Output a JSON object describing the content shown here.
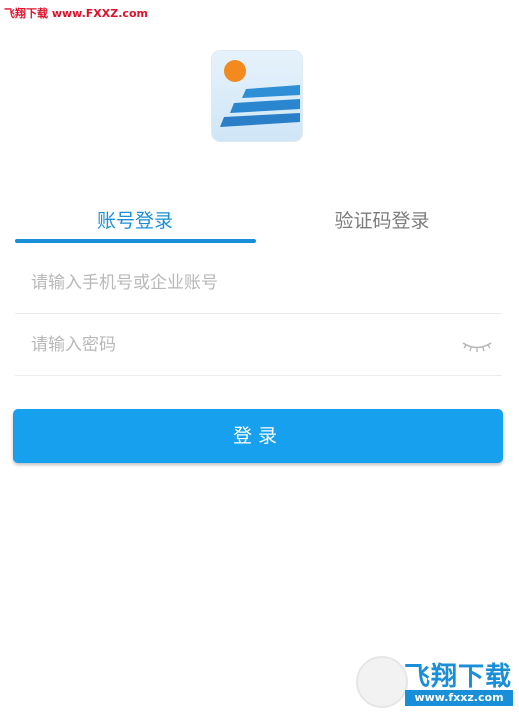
{
  "watermark": {
    "top_text": "飞翔下载 www.FXXZ.com",
    "bottom_title": "飞翔下载",
    "bottom_url": "www.fxxz.com"
  },
  "tabs": [
    {
      "label": "账号登录",
      "active": true
    },
    {
      "label": "验证码登录",
      "active": false
    }
  ],
  "form": {
    "account_placeholder": "请输入手机号或企业账号",
    "password_placeholder": "请输入密码"
  },
  "login_button": {
    "label": "登录"
  },
  "icons": {
    "logo": "app-logo-icon",
    "password_toggle": "eye-closed-icon"
  },
  "colors": {
    "accent": "#1a8fd9",
    "button": "#17a0ee",
    "logo_sun": "#f38a1e",
    "watermark_red": "#e0102a"
  }
}
